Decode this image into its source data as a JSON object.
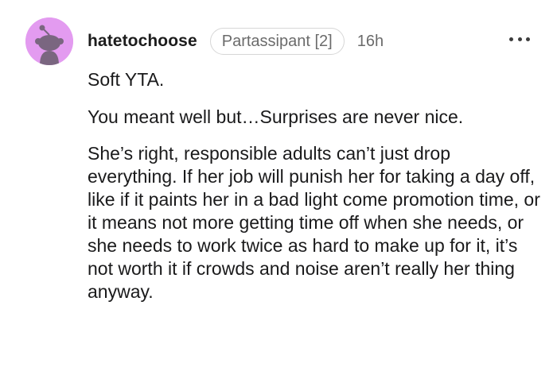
{
  "comment": {
    "username": "hatetochoose",
    "flair": "Partassipant [2]",
    "timestamp": "16h",
    "more_icon": "more-horizontal-icon",
    "avatar_color": "#e39bf0",
    "paragraphs": [
      "Soft YTA.",
      "You meant well but…Surprises are never nice.",
      "She’s right, responsible adults can’t just drop everything. If her job will punish her for taking a day off, like if it paints her in a bad light come promotion time, or it means not more getting time off when she needs, or she needs to work twice as hard to make up for it, it’s not worth it if crowds and noise aren’t really her thing anyway."
    ]
  }
}
